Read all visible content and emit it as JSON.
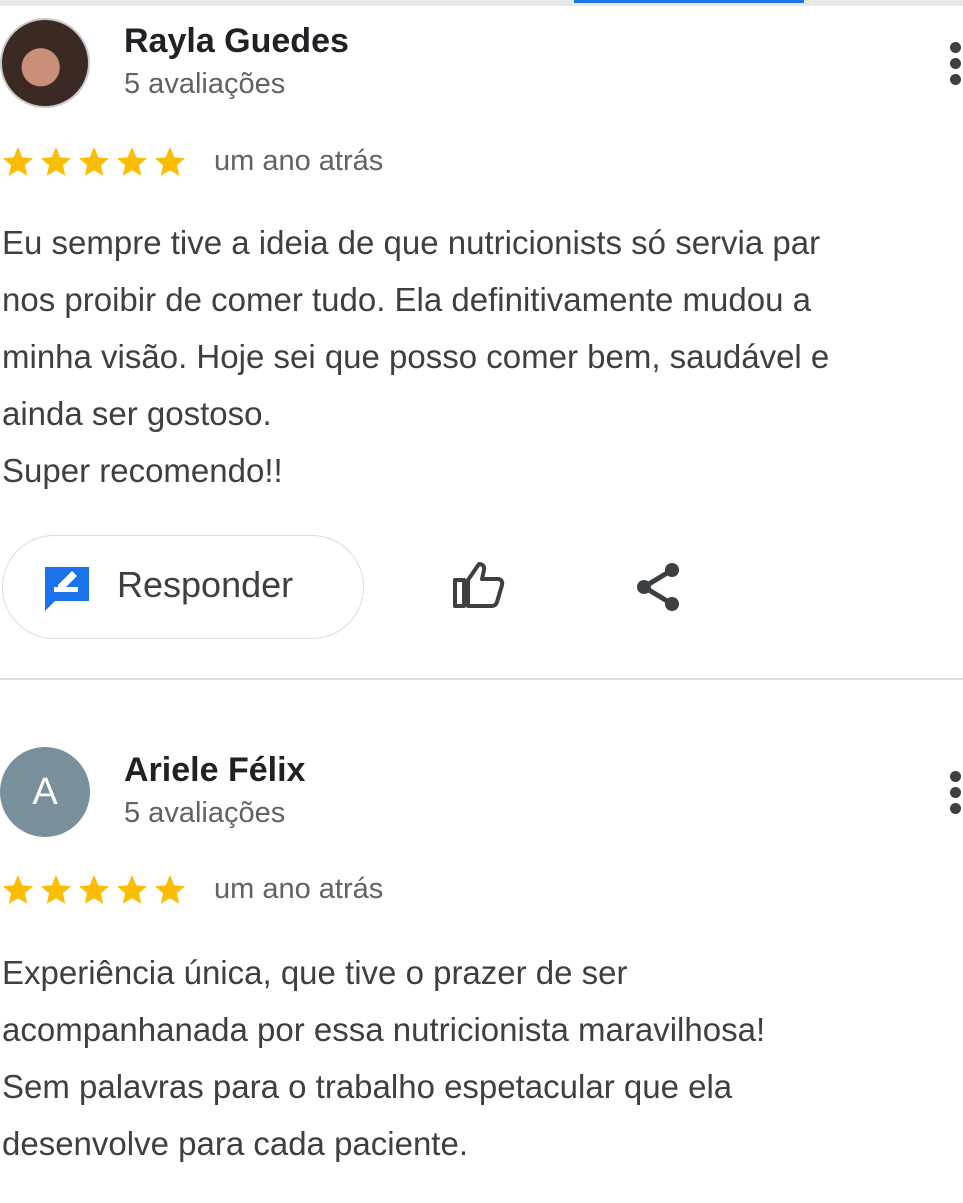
{
  "reviews": [
    {
      "name": "Rayla Guedes",
      "count": "5 avaliações",
      "avatar": "profile-photo",
      "rating": 5,
      "time": "um ano atrás",
      "lines": [
        "Eu sempre tive a ideia de que nutricionists só servia par",
        "nos proibir de comer tudo. Ela definitivamente mudou a",
        "minha visão. Hoje sei que posso comer bem, saudável e",
        "ainda ser gostoso.",
        "Super recomendo!!"
      ]
    },
    {
      "name": "Ariele Félix",
      "count": "5 avaliações",
      "avatar_letter": "A",
      "rating": 5,
      "time": "um ano atrás",
      "lines": [
        "Experiência única, que tive o prazer de ser",
        "acompanhanada por essa nutricionista maravilhosa!",
        "Sem palavras para o trabalho espetacular que ela",
        "desenvolve para cada paciente."
      ]
    }
  ],
  "actions": {
    "reply_label": "Responder",
    "reply_icon": "reply-edit-icon",
    "like_icon": "thumbs-up-icon",
    "share_icon": "share-icon",
    "menu_icon": "more-vert-icon"
  },
  "colors": {
    "star": "#fbbc04",
    "accent": "#1a73e8",
    "avatar_letter_bg": "#78909c"
  }
}
